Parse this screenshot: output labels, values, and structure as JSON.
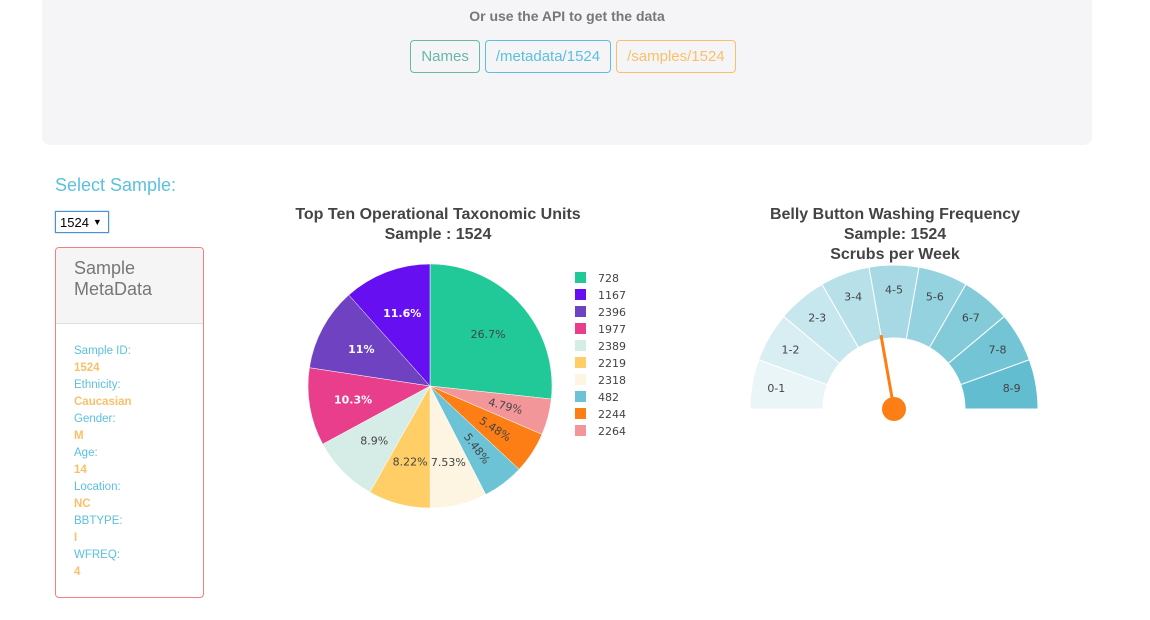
{
  "api": {
    "note": "Or use the API to get the data",
    "links": [
      {
        "label": "Names",
        "color": "#67b8a7"
      },
      {
        "label": "/metadata/1524",
        "color": "#5bc0de"
      },
      {
        "label": "/samples/1524",
        "color": "#f9c06a"
      }
    ]
  },
  "select": {
    "label": "Select Sample:",
    "value": "1524"
  },
  "metadata": {
    "title": "Sample MetaData",
    "fields": [
      {
        "label": "Sample ID:",
        "value": "1524"
      },
      {
        "label": "Ethnicity:",
        "value": "Caucasian"
      },
      {
        "label": "Gender:",
        "value": "M"
      },
      {
        "label": "Age:",
        "value": "14"
      },
      {
        "label": "Location:",
        "value": "NC"
      },
      {
        "label": "BBTYPE:",
        "value": "I"
      },
      {
        "label": "WFREQ:",
        "value": "4"
      }
    ]
  },
  "chart_data": [
    {
      "type": "pie",
      "title": "Top Ten Operational Taxonomic Units",
      "subtitle": "Sample : 1524",
      "labels": [
        "728",
        "1167",
        "2396",
        "1977",
        "2389",
        "2219",
        "2318",
        "482",
        "2244",
        "2264"
      ],
      "percent_labels": [
        "26.7%",
        "11.6%",
        "11%",
        "10.3%",
        "8.9%",
        "8.22%",
        "7.53%",
        "5.48%",
        "5.48%",
        "4.79%"
      ],
      "values": [
        26.7,
        11.6,
        11.0,
        10.3,
        8.9,
        8.22,
        7.53,
        5.48,
        5.48,
        4.79
      ],
      "colors": [
        "#20c997",
        "#6610f2",
        "#6f42c1",
        "#e83e8c",
        "#d5ede6",
        "#ffce67",
        "#fdf5e1",
        "#6cc3d5",
        "#fd7e14",
        "#f3969a"
      ],
      "slice_order_clockwise": [
        "728",
        "2264",
        "2244",
        "482",
        "2318",
        "2219",
        "2389",
        "1977",
        "2396",
        "1167"
      ],
      "legend_position": "right"
    },
    {
      "type": "gauge",
      "title": "Belly Button Washing Frequency",
      "subtitle": "Sample: 1524",
      "subtitle2": "Scrubs per Week",
      "segments": [
        "0-1",
        "1-2",
        "2-3",
        "3-4",
        "4-5",
        "5-6",
        "6-7",
        "7-8",
        "8-9"
      ],
      "segment_colors": [
        "#eaf5f8",
        "#d8eef3",
        "#c7e7ee",
        "#b7e0e9",
        "#a6d9e4",
        "#95d2df",
        "#84cbda",
        "#73c4d5",
        "#62bdd0"
      ],
      "range": [
        0,
        9
      ],
      "value": 4,
      "needle_color": "#fd7e14"
    }
  ]
}
